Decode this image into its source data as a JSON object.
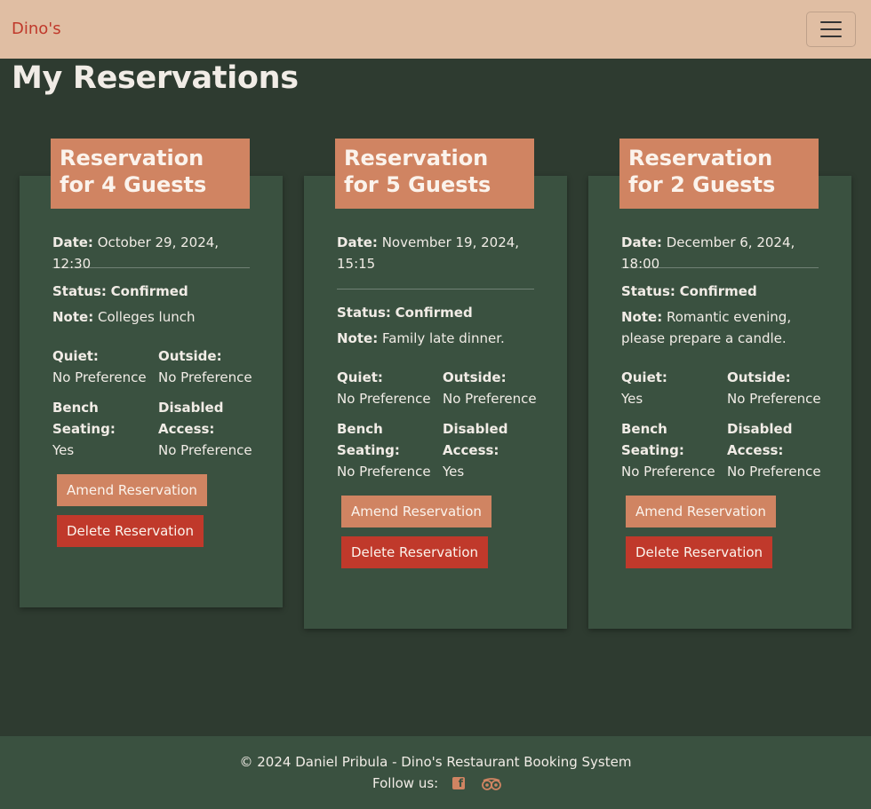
{
  "navbar": {
    "brand": "Dino's"
  },
  "page": {
    "title": "My Reservations"
  },
  "reservations": [
    {
      "title": "Reservation for 4 Guests",
      "date_label": "Date:",
      "date": "October 29, 2024, 12:30",
      "status_label": "Status:",
      "status": "Confirmed",
      "note_label": "Note:",
      "note": "Colleges lunch",
      "quiet_label": "Quiet:",
      "quiet": "No Preference",
      "outside_label": "Outside:",
      "outside": "No Preference",
      "bench_label": "Bench Seating:",
      "bench": "Yes",
      "disabled_label": "Disabled Access:",
      "disabled": "No Preference",
      "amend_label": "Amend Reservation",
      "delete_label": "Delete Reservation"
    },
    {
      "title": "Reservation for 5 Guests",
      "date_label": "Date:",
      "date": "November 19, 2024, 15:15",
      "status_label": "Status:",
      "status": "Confirmed",
      "note_label": "Note:",
      "note": "Family late dinner.",
      "quiet_label": "Quiet:",
      "quiet": "No Preference",
      "outside_label": "Outside:",
      "outside": "No Preference",
      "bench_label": "Bench Seating:",
      "bench": "No Preference",
      "disabled_label": "Disabled Access:",
      "disabled": "Yes",
      "amend_label": "Amend Reservation",
      "delete_label": "Delete Reservation"
    },
    {
      "title": "Reservation for 2 Guests",
      "date_label": "Date:",
      "date": "December 6, 2024, 18:00",
      "status_label": "Status:",
      "status": "Confirmed",
      "note_label": "Note:",
      "note": "Romantic evening, please prepare a candle.",
      "quiet_label": "Quiet:",
      "quiet": "Yes",
      "outside_label": "Outside:",
      "outside": "No Preference",
      "bench_label": "Bench Seating:",
      "bench": "No Preference",
      "disabled_label": "Disabled Access:",
      "disabled": "No Preference",
      "amend_label": "Amend Reservation",
      "delete_label": "Delete Reservation"
    }
  ],
  "footer": {
    "copyright": "© 2024 Daniel Pribula - Dino's Restaurant Booking System",
    "follow_label": "Follow us:",
    "social_icons": [
      "facebook-icon",
      "tripadvisor-icon"
    ]
  },
  "colors": {
    "navbar_bg": "#e0bea3",
    "page_bg": "#2e3b30",
    "card_bg": "#3a5140",
    "accent": "#d08462",
    "danger": "#c0392b"
  }
}
